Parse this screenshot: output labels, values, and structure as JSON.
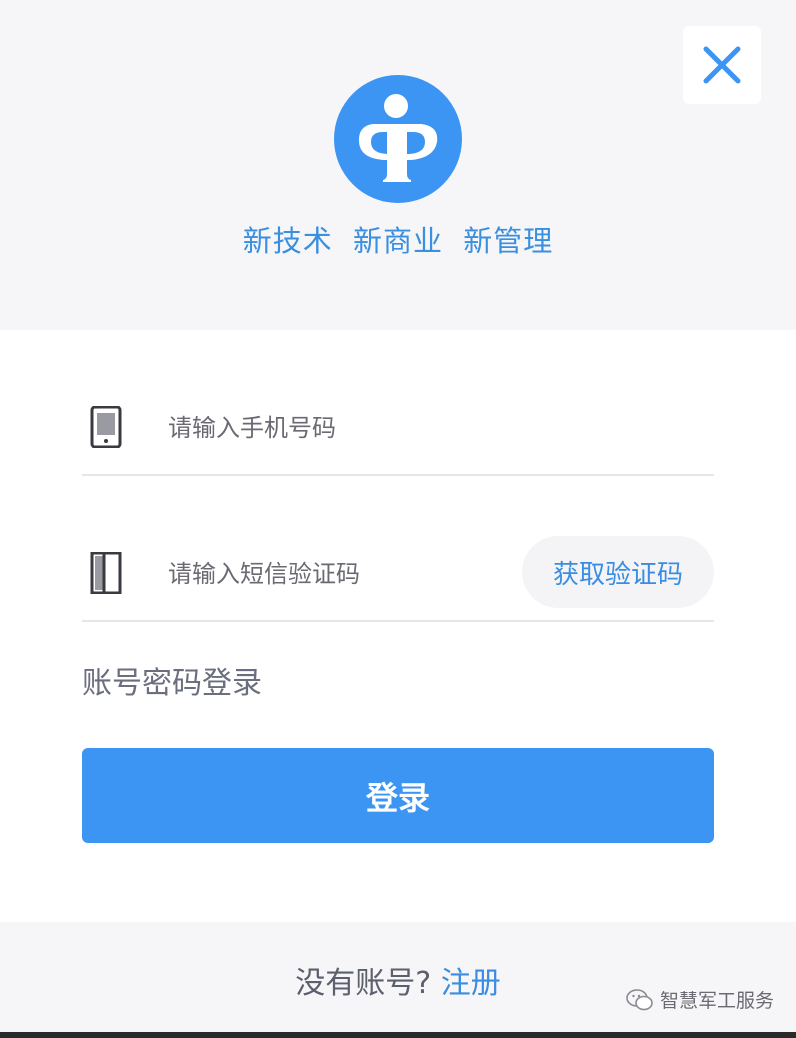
{
  "header": {
    "slogan": "新技术  新商业  新管理"
  },
  "icons": {
    "close": "close-icon",
    "logo": "brand-logo",
    "phone": "phone-icon",
    "sms": "sms-code-icon",
    "wechat": "wechat-icon"
  },
  "form": {
    "phone_placeholder": "请输入手机号码",
    "phone_value": "",
    "code_placeholder": "请输入短信验证码",
    "code_value": "",
    "get_code_label": "获取验证码",
    "password_login_label": "账号密码登录",
    "login_label": "登录"
  },
  "footer": {
    "prompt": "没有账号?",
    "register_label": "注册",
    "watermark": "智慧军工服务"
  },
  "colors": {
    "accent": "#3d95f3",
    "link": "#3a8de0",
    "header_bg": "#f6f6f8"
  }
}
